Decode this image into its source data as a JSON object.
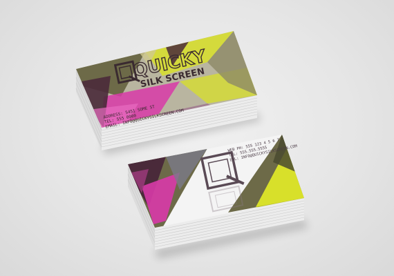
{
  "brand": {
    "name": "QUICKY",
    "tagline": "SILK SCREEN",
    "logo_mark": "Q"
  },
  "front_card": {
    "lines": [
      "ADDRESS: 5451 SOME ST",
      "TEL: 555 0000",
      "EMAIL: INFO@QUICKYSILKSCREEN.COM"
    ]
  },
  "back_card": {
    "lines": [
      "WEB PH: 555 123 4 5 6 7",
      "TEL: 555.555.5555",
      "EML: INFO@QUICKYSILKSCREEN.COM"
    ]
  },
  "colors": {
    "background": "#e6e6e6",
    "yellow": "#d8e02a",
    "magenta": "#d83aa8",
    "olive": "#6d6a48",
    "dark_plum": "#4a2a3a",
    "card_white": "#f4f4f4"
  }
}
